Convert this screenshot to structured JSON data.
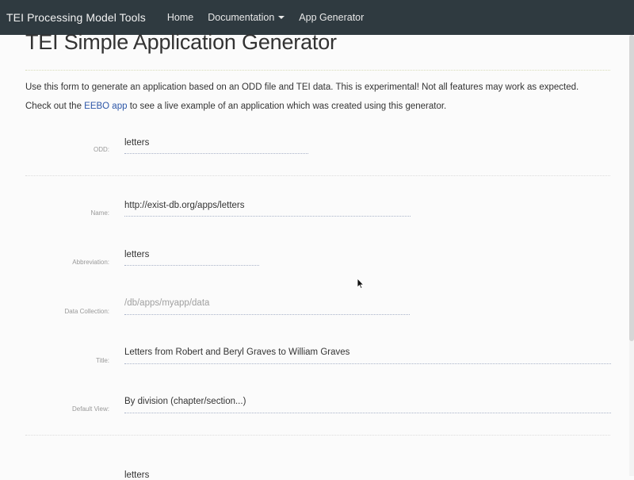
{
  "navbar": {
    "brand": "TEI Processing Model Tools",
    "items": [
      {
        "label": "Home"
      },
      {
        "label": "Documentation"
      },
      {
        "label": "App Generator"
      }
    ]
  },
  "page": {
    "title": "TEI Simple Application Generator",
    "intro_line1": "Use this form to generate an application based on an ODD file and TEI data. This is experimental! Not all features may work as expected.",
    "intro_line2_before": "Check out the ",
    "intro_line2_link": "EEBO app",
    "intro_line2_after": " to see a live example of an application which was created using this generator."
  },
  "form": {
    "odd": {
      "label": "ODD:",
      "value": "letters"
    },
    "name": {
      "label": "Name:",
      "value": "http://exist-db.org/apps/letters"
    },
    "abbreviation": {
      "label": "Abbreviation:",
      "value": "letters"
    },
    "data_collection": {
      "label": "Data Collection:",
      "placeholder": "/db/apps/myapp/data"
    },
    "title": {
      "label": "Title:",
      "value": "Letters from Robert and Beryl Graves to William Graves"
    },
    "default_view": {
      "label": "Default View:",
      "value": "By division (chapter/section...)"
    },
    "next_value": "letters"
  }
}
